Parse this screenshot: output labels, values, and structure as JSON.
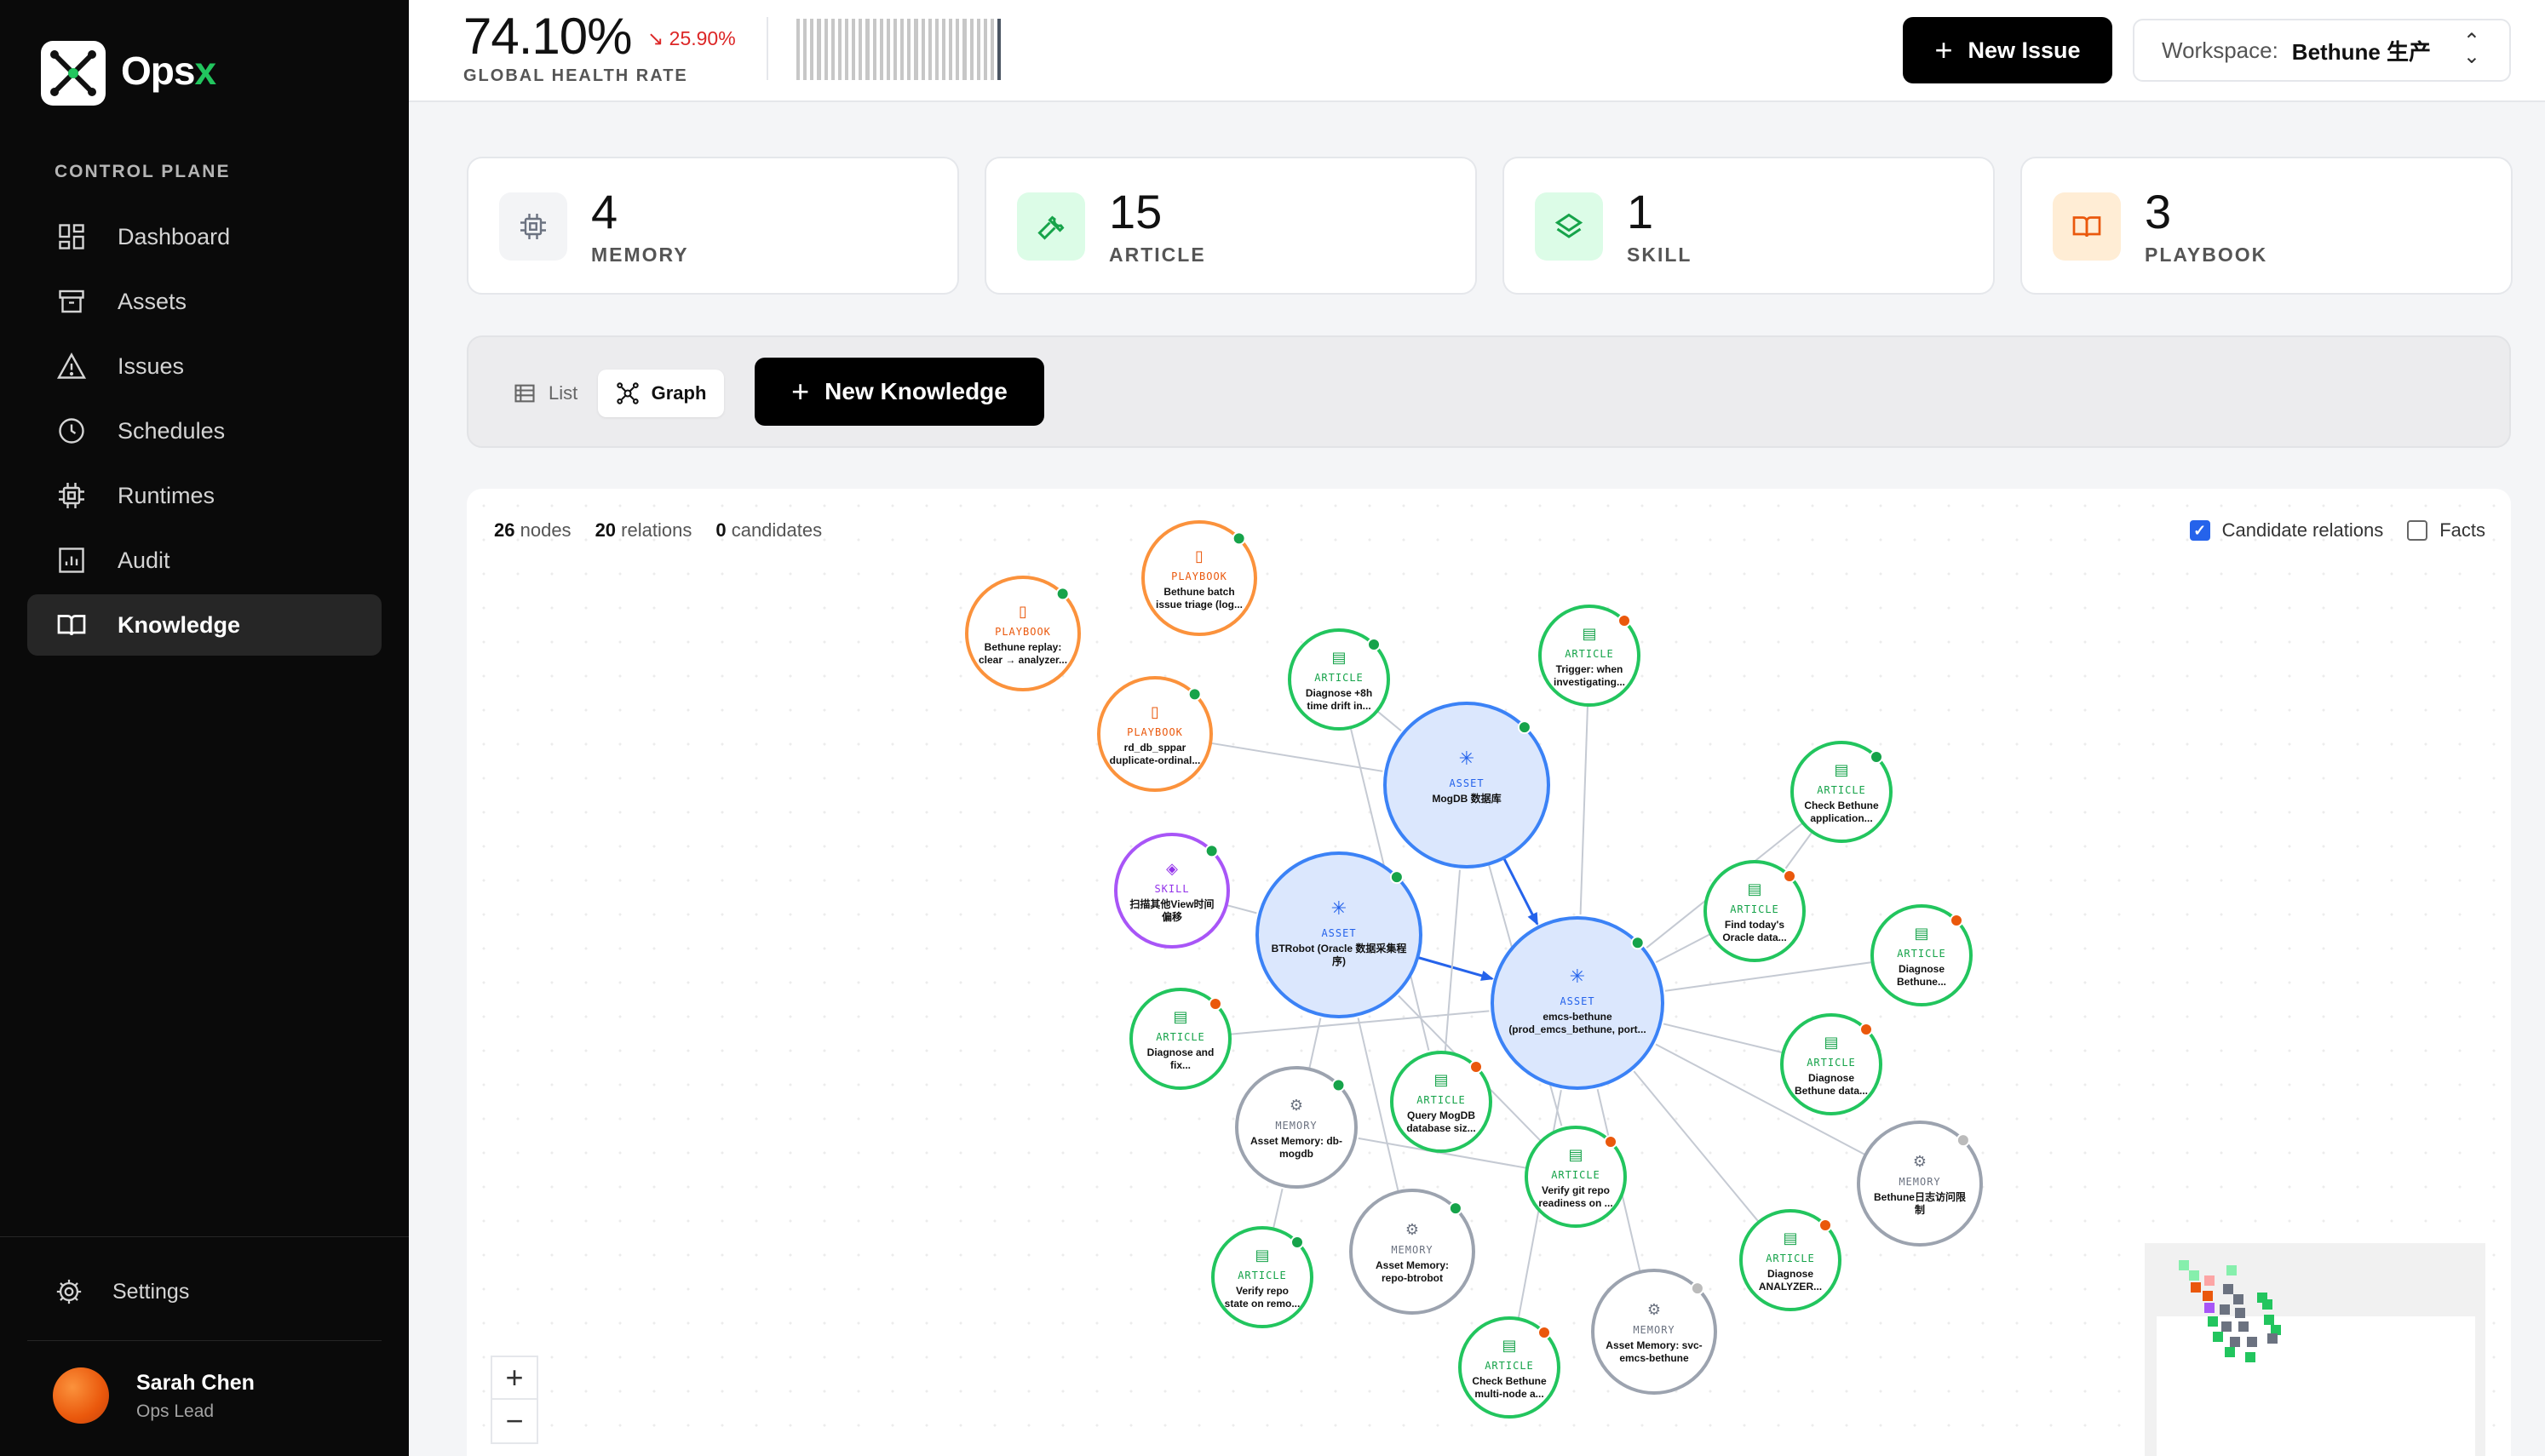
{
  "app": {
    "name_main": "Ops",
    "name_accent": "x"
  },
  "sidebar": {
    "section": "CONTROL PLANE",
    "items": [
      {
        "label": "Dashboard",
        "icon": "dashboard-icon"
      },
      {
        "label": "Assets",
        "icon": "archive-icon"
      },
      {
        "label": "Issues",
        "icon": "warning-icon"
      },
      {
        "label": "Schedules",
        "icon": "clock-icon"
      },
      {
        "label": "Runtimes",
        "icon": "chip-icon"
      },
      {
        "label": "Audit",
        "icon": "report-icon"
      },
      {
        "label": "Knowledge",
        "icon": "book-icon",
        "active": true
      }
    ],
    "settings": "Settings",
    "user": {
      "name": "Sarah Chen",
      "role": "Ops Lead"
    }
  },
  "topbar": {
    "health_value": "74.10%",
    "health_delta": "25.90%",
    "health_label": "GLOBAL HEALTH RATE",
    "new_issue": "New Issue",
    "workspace_label": "Workspace:",
    "workspace_value": "Bethune 生产"
  },
  "cards": [
    {
      "count": "4",
      "label": "MEMORY",
      "icon": "chip-icon",
      "color": "#6b7280",
      "bg": "#f3f4f6"
    },
    {
      "count": "15",
      "label": "ARTICLE",
      "icon": "wrench-icon",
      "color": "#16a34a",
      "bg": "#dcfce7"
    },
    {
      "count": "1",
      "label": "SKILL",
      "icon": "layers-icon",
      "color": "#16a34a",
      "bg": "#dcfce7"
    },
    {
      "count": "3",
      "label": "PLAYBOOK",
      "icon": "book-icon",
      "color": "#ea580c",
      "bg": "#ffedd5"
    }
  ],
  "view": {
    "list": "List",
    "graph": "Graph",
    "new_knowledge": "New Knowledge"
  },
  "graph": {
    "nodes_count": "26",
    "nodes_label": "nodes",
    "relations_count": "20",
    "relations_label": "relations",
    "candidates_count": "0",
    "candidates_label": "candidates",
    "candidate_relations": "Candidate relations",
    "facts": "Facts",
    "zoom_in": "+",
    "zoom_out": "−",
    "colors": {
      "asset": "#3b82f6",
      "article": "#22c55e",
      "memory": "#9ca3af",
      "playbook": "#fb923c",
      "skill": "#a855f7"
    },
    "nodes": [
      {
        "type": "PLAYBOOK",
        "l1": "Bethune batch",
        "l2": "issue triage (log..."
      },
      {
        "type": "PLAYBOOK",
        "l1": "Bethune replay:",
        "l2": "clear → analyzer..."
      },
      {
        "type": "PLAYBOOK",
        "l1": "rd_db_sppar",
        "l2": "duplicate-ordinal..."
      },
      {
        "type": "ARTICLE",
        "l1": "Diagnose +8h",
        "l2": "time drift in..."
      },
      {
        "type": "ARTICLE",
        "l1": "Trigger: when",
        "l2": "investigating..."
      },
      {
        "type": "ASSET",
        "l1": "MogDB 数据库",
        "l2": ""
      },
      {
        "type": "SKILL",
        "l1": "扫描其他View时间",
        "l2": "偏移"
      },
      {
        "type": "ASSET",
        "l1": "BTRobot (Oracle 数据采集程",
        "l2": "序)"
      },
      {
        "type": "ASSET",
        "l1": "emcs-bethune",
        "l2": "(prod_emcs_bethune, port..."
      },
      {
        "type": "ARTICLE",
        "l1": "Check Bethune",
        "l2": "application..."
      },
      {
        "type": "ARTICLE",
        "l1": "Find today's",
        "l2": "Oracle data..."
      },
      {
        "type": "ARTICLE",
        "l1": "Diagnose",
        "l2": "Bethune..."
      },
      {
        "type": "ARTICLE",
        "l1": "Diagnose and",
        "l2": "fix..."
      },
      {
        "type": "MEMORY",
        "l1": "Asset Memory: db-",
        "l2": "mogdb"
      },
      {
        "type": "ARTICLE",
        "l1": "Query MogDB",
        "l2": "database siz..."
      },
      {
        "type": "ARTICLE",
        "l1": "Verify git repo",
        "l2": "readiness on ..."
      },
      {
        "type": "ARTICLE",
        "l1": "Diagnose",
        "l2": "Bethune data..."
      },
      {
        "type": "MEMORY",
        "l1": "Bethune日志访问限",
        "l2": "制"
      },
      {
        "type": "ARTICLE",
        "l1": "Verify repo",
        "l2": "state on remo..."
      },
      {
        "type": "MEMORY",
        "l1": "Asset Memory:",
        "l2": "repo-btrobot"
      },
      {
        "type": "ARTICLE",
        "l1": "Diagnose",
        "l2": "ANALYZER..."
      },
      {
        "type": "MEMORY",
        "l1": "Asset Memory: svc-",
        "l2": "emcs-bethune"
      },
      {
        "type": "ARTICLE",
        "l1": "Check Bethune",
        "l2": "multi-node a..."
      }
    ]
  }
}
